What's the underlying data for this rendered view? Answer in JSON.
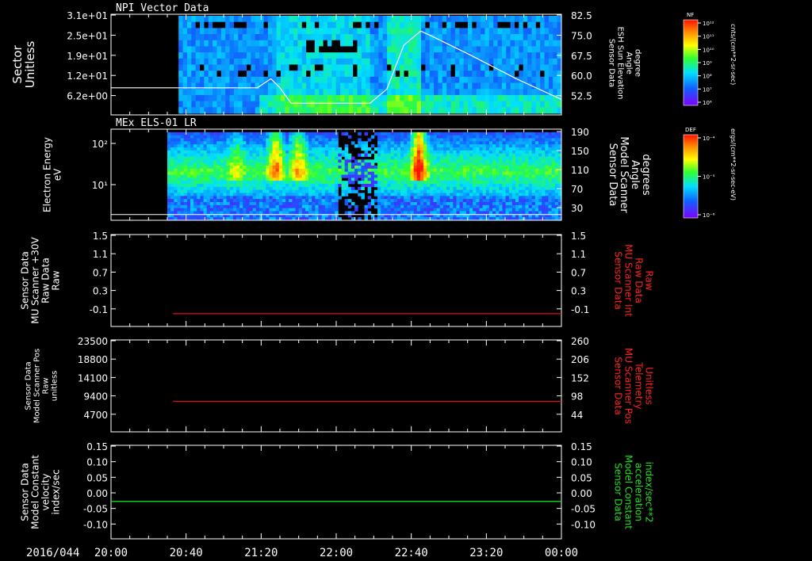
{
  "date_label": "2016/044",
  "time_ticks": [
    "20:00",
    "20:40",
    "21:20",
    "22:00",
    "22:40",
    "23:20",
    "00:00"
  ],
  "time_range_hours": [
    20,
    24
  ],
  "colors": {
    "background": "#000000",
    "axis": "#ffffff",
    "red_trace": "#e01010",
    "green_trace": "#10e010",
    "right_label_red": "#ff2020",
    "right_label_green": "#20e020"
  },
  "chart_data": [
    {
      "type": "heatmap",
      "title": "NPI Vector Data",
      "ylabel": [
        "Sector",
        "Unitless"
      ],
      "yticks_left": [
        "3.1e+01",
        "2.5e+01",
        "1.9e+01",
        "1.2e+01",
        "6.2e+00"
      ],
      "yticks_right": [
        "82.5",
        "75.0",
        "67.5",
        "60.0",
        "52.5"
      ],
      "ylabel_right": [
        "Sensor Data",
        "ESH Sun Elevation",
        "Angle",
        "degree"
      ],
      "colorbar": {
        "label": "NF",
        "unit": "cnts/(cm**2-sr-sec)",
        "ticks": [
          "10¹²",
          "10¹¹",
          "10¹⁰",
          "10⁹",
          "10⁸",
          "10⁷",
          "10⁶"
        ]
      },
      "data_start_hour": 20.6,
      "overlay_line": {
        "name": "ESH Sun Elevation Angle",
        "ylim": [
          47,
          86
        ],
        "x": [
          20.0,
          20.6,
          21.3,
          21.42,
          21.5,
          21.6,
          21.8,
          22.1,
          22.3,
          22.45,
          22.6,
          22.75,
          22.85,
          23.2,
          23.6,
          24.0
        ],
        "y": [
          57.5,
          57.5,
          57.5,
          61.0,
          57.5,
          51.5,
          51.5,
          51.5,
          51.5,
          57.0,
          74.0,
          79.5,
          77.5,
          70.0,
          61.0,
          53.0
        ]
      }
    },
    {
      "type": "heatmap",
      "title": "MEx ELS-01 LR",
      "ylabel": [
        "Electron Energy",
        "eV"
      ],
      "yticks_left": [
        "10²",
        "10¹"
      ],
      "yticks_right": [
        "190",
        "150",
        "110",
        "70",
        "30"
      ],
      "ylabel_right": [
        "Sensor Data",
        "Model Scanner",
        "Angle",
        "degrees"
      ],
      "colorbar": {
        "label": "DEF",
        "unit": "ergs/(cm**2-sr-sec-eV)",
        "ticks": [
          "10⁻⁴",
          "10⁻⁵",
          "10⁻⁶"
        ]
      },
      "data_start_hour": 20.5,
      "overlay_line": {
        "name": "Model Scanner Angle",
        "ylim": [
          0,
          190
        ],
        "x": [
          20.0,
          24.0
        ],
        "y": [
          12,
          12
        ]
      }
    },
    {
      "type": "line",
      "ylabel": [
        "Sensor Data",
        "MU Scanner +30V",
        "Raw Data",
        "Raw"
      ],
      "yticks_left": [
        "1.5",
        "1.1",
        "0.7",
        "0.3",
        "-0.1"
      ],
      "yticks_right": [
        "1.5",
        "1.1",
        "0.7",
        "0.3",
        "-0.1"
      ],
      "ylabel_right": [
        "Sensor Data",
        "MU Scanner Int",
        "Raw Data",
        "Raw"
      ],
      "ylim": [
        -0.3,
        1.5
      ],
      "series": [
        {
          "x": [
            20.55,
            24.0
          ],
          "y": [
            -0.05,
            -0.05
          ],
          "color": "#e01010"
        }
      ]
    },
    {
      "type": "line",
      "ylabel": [
        "Sensor Data",
        "Model Scanner Pos",
        "Raw",
        "unitless"
      ],
      "yticks_left": [
        "23500",
        "18800",
        "14100",
        "9400",
        "4700"
      ],
      "yticks_right": [
        "260",
        "206",
        "152",
        "98",
        "44"
      ],
      "ylabel_right": [
        "Sensor Data",
        "MU Scanner Pos",
        "Telemetry",
        "Unitless"
      ],
      "ylim": [
        0,
        23500
      ],
      "series": [
        {
          "x": [
            20.55,
            24.0
          ],
          "y": [
            7800,
            7800
          ],
          "color": "#e01010"
        }
      ]
    },
    {
      "type": "line",
      "ylabel": [
        "Sensor Data",
        "Model Constant",
        "velocity",
        "index/sec"
      ],
      "yticks_left": [
        "0.15",
        "0.10",
        "0.05",
        "0.00",
        "-0.05",
        "-0.10"
      ],
      "yticks_right": [
        "0.15",
        "0.10",
        "0.05",
        "0.00",
        "-0.05",
        "-0.10"
      ],
      "ylabel_right": [
        "Sensor Data",
        "Model Constant",
        "acceleration",
        "index/sec**2"
      ],
      "ylim": [
        -0.1,
        0.15
      ],
      "series": [
        {
          "x": [
            20.0,
            24.0
          ],
          "y": [
            0.0,
            0.0
          ],
          "color": "#10e010"
        }
      ]
    }
  ]
}
